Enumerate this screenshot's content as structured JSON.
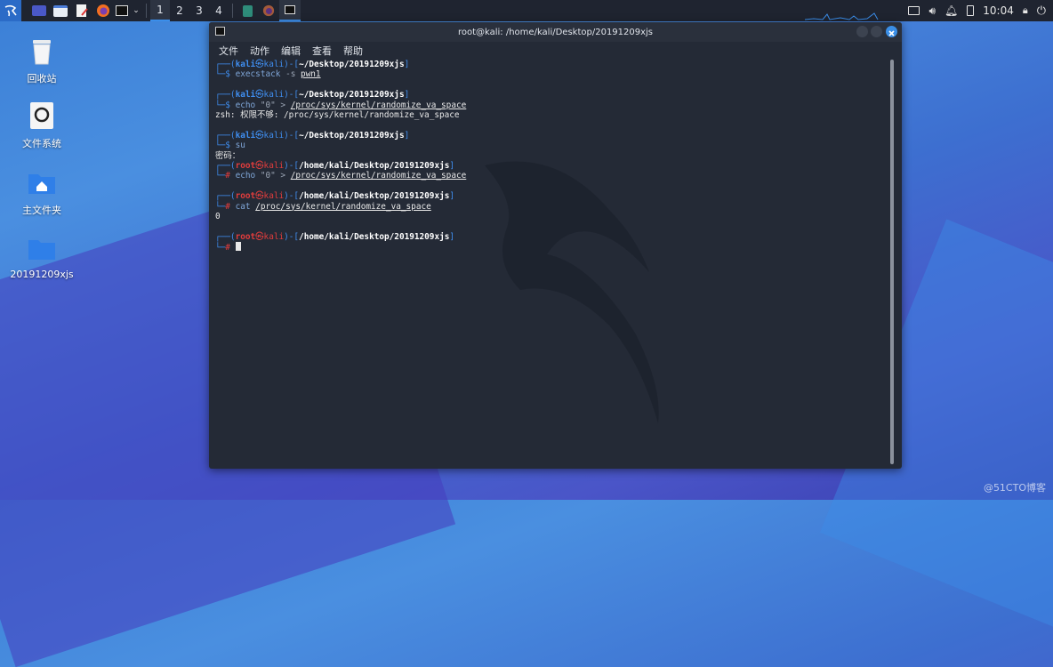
{
  "taskbar": {
    "workspaces": [
      "1",
      "2",
      "3",
      "4"
    ],
    "active_workspace": "1",
    "clock": "10:04",
    "icons": [
      "kali-menu-icon",
      "desktop-icon",
      "file-manager-icon",
      "text-editor-icon",
      "firefox-icon",
      "terminal-icon",
      "chevron-down-icon"
    ]
  },
  "desktop": {
    "icons": [
      {
        "label": "回收站",
        "icon": "trash-icon"
      },
      {
        "label": "文件系统",
        "icon": "drive-icon"
      },
      {
        "label": "主文件夹",
        "icon": "home-folder-icon"
      },
      {
        "label": "20191209xjs",
        "icon": "folder-icon"
      }
    ]
  },
  "terminal": {
    "title": "root@kali: /home/kali/Desktop/20191209xjs",
    "menu": [
      "文件",
      "动作",
      "编辑",
      "查看",
      "帮助"
    ],
    "blocks": [
      {
        "user": "kali",
        "host": "kali",
        "path": "~/Desktop/20191209xjs",
        "prompt": "$",
        "cmd": "execstack",
        "args": " -s ",
        "target": "pwn1",
        "output": ""
      },
      {
        "user": "kali",
        "host": "kali",
        "path": "~/Desktop/20191209xjs",
        "prompt": "$",
        "cmd": "echo",
        "args": " \"0\" > ",
        "target": "/proc/sys/kernel/randomize_va_space",
        "output": "zsh: 权限不够: /proc/sys/kernel/randomize_va_space"
      },
      {
        "user": "kali",
        "host": "kali",
        "path": "~/Desktop/20191209xjs",
        "prompt": "$",
        "cmd": "su",
        "args": "",
        "target": "",
        "output": "密码："
      },
      {
        "user": "root",
        "host": "kali",
        "path": "/home/kali/Desktop/20191209xjs",
        "prompt": "#",
        "cmd": "echo",
        "args": " \"0\" > ",
        "target": "/proc/sys/kernel/randomize_va_space",
        "output": ""
      },
      {
        "user": "root",
        "host": "kali",
        "path": "/home/kali/Desktop/20191209xjs",
        "prompt": "#",
        "cmd": "cat",
        "args": " ",
        "target": "/proc/sys/kernel/randomize_va_space",
        "output": "0"
      },
      {
        "user": "root",
        "host": "kali",
        "path": "/home/kali/Desktop/20191209xjs",
        "prompt": "#",
        "cmd": "",
        "args": "",
        "target": "",
        "output": ""
      }
    ]
  },
  "watermark": "@51CTO博客"
}
